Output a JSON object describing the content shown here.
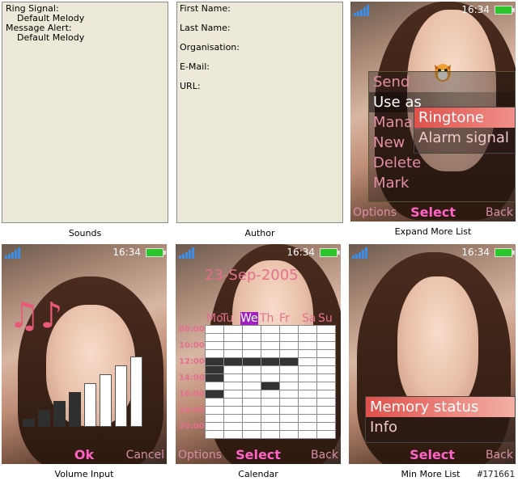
{
  "sounds_panel": {
    "ring_label": "Ring Signal:",
    "ring_value": "Default Melody",
    "msg_label": "Message Alert:",
    "msg_value": "Default Melody",
    "caption": "Sounds"
  },
  "author_panel": {
    "fields": [
      "First Name:",
      "Last Name:",
      "Organisation:",
      "E-Mail:",
      "URL:"
    ],
    "caption": "Author"
  },
  "status": {
    "time": "16:34"
  },
  "expand_list": {
    "caption": "Expand More List",
    "items": [
      "Send",
      "Use as",
      "Manage",
      "New",
      "Delete",
      "Mark"
    ],
    "selected": 1,
    "submenu": [
      "Ringtone",
      "Alarm signal"
    ],
    "sub_selected": 0,
    "softkeys": {
      "left": "Options",
      "mid": "Select",
      "right": "Back"
    }
  },
  "volume": {
    "caption": "Volume Input",
    "level": 4,
    "max": 8,
    "note_icon": "music-notes",
    "softkeys": {
      "mid": "Ok",
      "right": "Cancel"
    }
  },
  "calendar": {
    "caption": "Calendar",
    "date": "23-Sep-2005",
    "weekdays": [
      "Mo",
      "Tu",
      "We",
      "Th",
      "Fr",
      "Sa",
      "Su"
    ],
    "selected_day": "We",
    "hours": [
      "08:00",
      "10:00",
      "12:00",
      "14:00",
      "16:00",
      "18:00",
      "20:00"
    ],
    "softkeys": {
      "left": "Options",
      "mid": "Select",
      "right": "Back"
    }
  },
  "min_list": {
    "caption": "Min More List",
    "items": [
      "Memory status",
      "Info"
    ],
    "selected": 0,
    "softkeys": {
      "mid": "Select",
      "right": "Back"
    }
  },
  "watermark": "#171661",
  "colors": {
    "accent": "#ff63c6",
    "menu_text": "#e38ea3",
    "battery": "#2cc52c",
    "panel_bg": "#ece9d8"
  }
}
